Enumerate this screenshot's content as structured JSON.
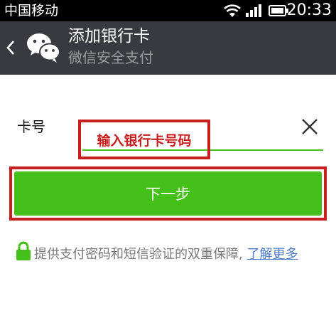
{
  "status_bar": {
    "carrier": "中国移动",
    "time": "20:33"
  },
  "header": {
    "title": "添加银行卡",
    "subtitle": "微信安全支付"
  },
  "form": {
    "card_label": "卡号",
    "card_placeholder": "",
    "card_value": "",
    "annotation_text": "输入银行卡号码"
  },
  "next_button": {
    "label": "下一步"
  },
  "security": {
    "note": "提供支付密码和短信验证的双重保障, ",
    "learn_more": "了解更多"
  },
  "colors": {
    "brand_green": "#45c01a",
    "annotation_red": "#c7201f",
    "title_bar": "#393a3f",
    "link_blue": "#4c7ac9"
  },
  "icons": [
    "wifi-icon",
    "signal-icon",
    "battery-icon",
    "back-icon",
    "wechat-logo",
    "clear-icon",
    "lock-icon"
  ]
}
